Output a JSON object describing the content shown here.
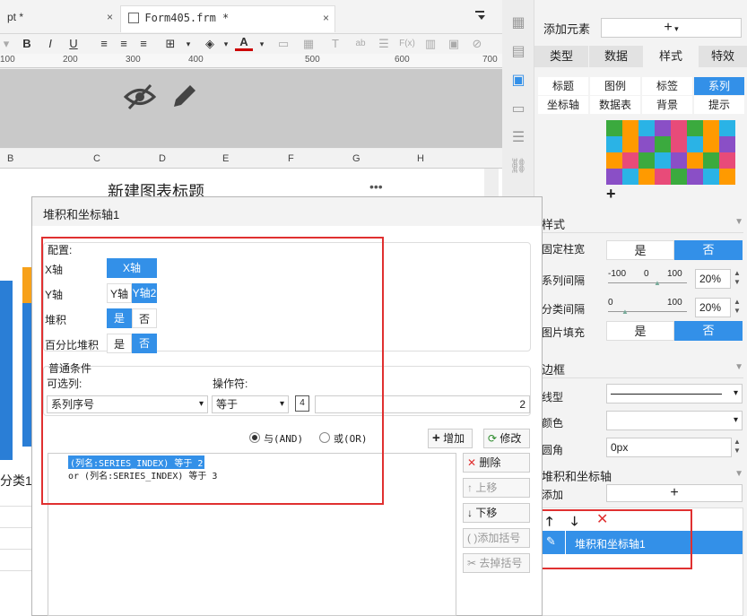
{
  "tabs": [
    {
      "label": "pt *",
      "close": "×"
    },
    {
      "label": "Form405.frm *",
      "close": "×"
    }
  ],
  "ruler": {
    "marks": [
      "100",
      "200",
      "300",
      "400",
      "500",
      "600",
      "700"
    ]
  },
  "columns": [
    "B",
    "C",
    "D",
    "E",
    "F",
    "G",
    "H"
  ],
  "chart": {
    "title": "新建图表标题",
    "more": "•••",
    "category_label": "分类1"
  },
  "iconstrip": [
    "cell-element-icon",
    "attr-icon",
    "chart-icon",
    "widget-icon",
    "condition-icon",
    "link-icon"
  ],
  "panel": {
    "add_element_label": "添加元素",
    "add_element_btn": "+",
    "main_tabs": [
      "类型",
      "数据",
      "样式",
      "特效"
    ],
    "sub_tabs_row1": [
      "标题",
      "图例",
      "标签",
      "系列"
    ],
    "sub_tabs_row2": [
      "坐标轴",
      "数据表",
      "背景",
      "提示"
    ],
    "palette": [
      "#3baa3e",
      "#ff9a00",
      "#2ab3e6",
      "#8a4fc6",
      "#e84b79",
      "#3baa3e",
      "#ff9a00",
      "#2ab3e6",
      "#2ab3e6",
      "#ff9a00",
      "#8a4fc6",
      "#3baa3e",
      "#e84b79",
      "#2ab3e6",
      "#ff9a00",
      "#8a4fc6",
      "#ff9a00",
      "#e84b79",
      "#3baa3e",
      "#2ab3e6",
      "#8a4fc6",
      "#ff9a00",
      "#3baa3e",
      "#e84b79",
      "#8a4fc6",
      "#2ab3e6",
      "#ff9a00",
      "#e84b79",
      "#3baa3e",
      "#8a4fc6",
      "#2ab3e6",
      "#ff9a00"
    ],
    "palette_add": "+",
    "style_section": "样式",
    "fixed_width_label": "固定柱宽",
    "fixed_width_yes": "是",
    "fixed_width_no": "否",
    "series_gap_label": "系列间隔",
    "series_gap_min": "-100",
    "series_gap_mid": "0",
    "series_gap_max": "100",
    "series_gap_value": "20%",
    "cat_gap_label": "分类间隔",
    "cat_gap_min": "0",
    "cat_gap_max": "100",
    "cat_gap_value": "20%",
    "image_fill_label": "图片填充",
    "image_fill_yes": "是",
    "image_fill_no": "否",
    "border_section": "边框",
    "line_type_label": "线型",
    "color_label": "颜色",
    "radius_label": "圆角",
    "radius_value": "0px",
    "stack_section": "堆积和坐标轴",
    "add_label": "添加",
    "add_btn": "+",
    "list_item": "堆积和坐标轴1"
  },
  "dialog": {
    "title": "堆积和坐标轴1",
    "config_legend": "配置:",
    "xaxis_label": "X轴",
    "xaxis_value": "X轴",
    "yaxis_label": "Y轴",
    "yaxis_opt1": "Y轴",
    "yaxis_opt2": "Y轴2",
    "stack_label": "堆积",
    "stack_yes": "是",
    "stack_no": "否",
    "percent_label": "百分比堆积",
    "percent_yes": "是",
    "percent_no": "否",
    "cond_legend": "普通条件",
    "col_label": "可选列:",
    "op_label": "操作符:",
    "col_value": "系列序号",
    "op_value": "等于",
    "num_value": "2",
    "and_label": "与(AND)",
    "or_label": "或(OR)",
    "add_btn": "增加",
    "modify_btn": "修改",
    "cond_line1": "(列名:SERIES_INDEX) 等于 2",
    "cond_line2": "or  (列名:SERIES_INDEX) 等于 3",
    "delete_btn": "删除",
    "up_btn": "上移",
    "down_btn": "下移",
    "add_paren_btn": "添加括号",
    "remove_paren_btn": "去掉括号"
  }
}
